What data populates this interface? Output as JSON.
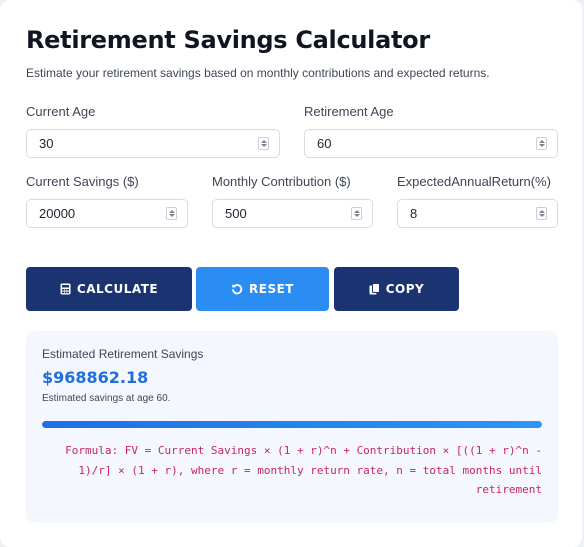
{
  "header": {
    "title": "Retirement Savings Calculator",
    "subtitle": "Estimate your retirement savings based on monthly contributions and expected returns."
  },
  "fields": {
    "current_age": {
      "label": "Current Age",
      "value": "30"
    },
    "retirement_age": {
      "label": "Retirement Age",
      "value": "60"
    },
    "current_savings": {
      "label": "Current Savings ($)",
      "value": "20000"
    },
    "monthly_contribution": {
      "label": "Monthly Contribution ($)",
      "value": "500"
    },
    "annual_return": {
      "label": "ExpectedAnnualReturn(%)",
      "value": "8"
    }
  },
  "buttons": {
    "calculate": {
      "label": "CALCULATE",
      "icon": "calculator-icon"
    },
    "reset": {
      "label": "RESET",
      "icon": "undo-icon"
    },
    "copy": {
      "label": "COPY",
      "icon": "copy-icon"
    }
  },
  "result": {
    "label": "Estimated Retirement Savings",
    "value": "$968862.18",
    "note": "Estimated savings at age 60.",
    "progress_fraction": 1.0,
    "formula": "Formula: FV = Current Savings × (1 + r)^n + Contribution × [((1 + r)^n - 1)/r] × (1 + r), where r = monthly return rate, n = total months until retirement"
  },
  "colors": {
    "primary_dark": "#1b3471",
    "primary_blue": "#2b8cf1",
    "result_value": "#1f6fe0",
    "formula_text": "#c7275f"
  }
}
